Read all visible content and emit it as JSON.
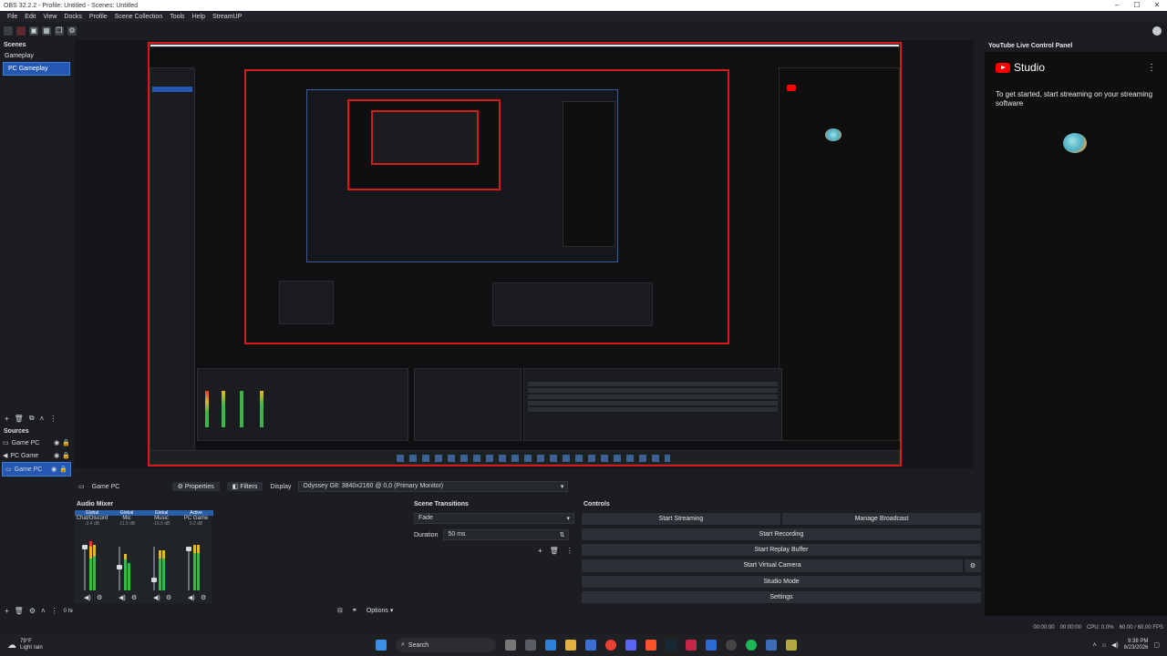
{
  "window": {
    "title": "OBS 32.2.2 - Profile: Untitled - Scenes: Untitled"
  },
  "menu": [
    "File",
    "Edit",
    "View",
    "Docks",
    "Profile",
    "Scene Collection",
    "Tools",
    "Help",
    "StreamUP"
  ],
  "scenes": {
    "title": "Scenes",
    "items": [
      {
        "label": "Gameplay"
      },
      {
        "label": "PC Gameplay"
      }
    ]
  },
  "sources": {
    "title": "Sources",
    "items": [
      {
        "label": "Game PC"
      },
      {
        "label": "PC Game"
      },
      {
        "label": "Game PC"
      }
    ],
    "hidden_label": "0 hidden"
  },
  "youtube": {
    "dock_title": "YouTube Live Control Panel",
    "studio_label": "Studio",
    "message": "To get started, start streaming on your streaming software"
  },
  "source_toolbar": {
    "source_name": "Game PC",
    "properties": "Properties",
    "filters": "Filters",
    "display_label": "Display",
    "display_value": "Odyssey G8: 3840x2160 @ 0,0 (Primary Monitor)"
  },
  "mixer": {
    "title": "Audio Mixer",
    "channels": [
      {
        "badge": "Global",
        "name": "Chat/Discord",
        "db": "-3.4 dB"
      },
      {
        "badge": "Global",
        "name": "Mic",
        "db": "-11.5 dB"
      },
      {
        "badge": "Global",
        "name": "Music",
        "db": "-16.5 dB"
      },
      {
        "badge": "Active",
        "name": "PC Game",
        "db": "0.0 dB"
      }
    ],
    "options": "Options"
  },
  "transitions": {
    "title": "Scene Transitions",
    "selected": "Fade",
    "duration_label": "Duration",
    "duration_value": "50 ms"
  },
  "controls": {
    "title": "Controls",
    "start_streaming": "Start Streaming",
    "manage_broadcast": "Manage Broadcast",
    "start_recording": "Start Recording",
    "start_replay": "Start Replay Buffer",
    "start_vcam": "Start Virtual Camera",
    "studio_mode": "Studio Mode",
    "settings": "Settings"
  },
  "status": {
    "stream_time": "00:00:00",
    "rec_time": "00:00:00",
    "cpu": "CPU: 0.0%",
    "fps": "60.00 / 60.00 FPS"
  },
  "taskbar": {
    "weather_temp": "79°F",
    "weather_desc": "Light rain",
    "search": "Search",
    "time": "9:38 PM",
    "date": "8/23/2026"
  }
}
